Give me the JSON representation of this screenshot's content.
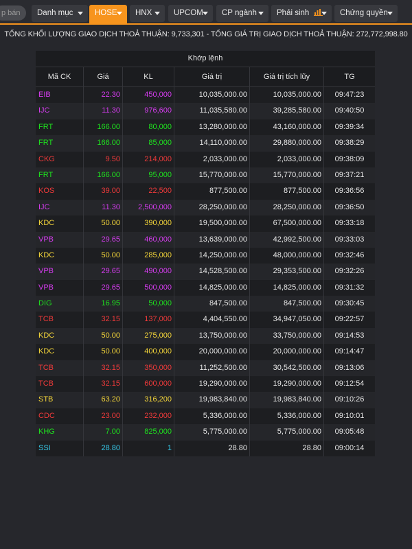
{
  "search": {
    "placeholder": "p bán"
  },
  "tabs": [
    {
      "label": "Danh mục",
      "active": false
    },
    {
      "label": "HOSE",
      "active": true
    },
    {
      "label": "HNX",
      "active": false
    },
    {
      "label": "UPCOM",
      "active": false
    },
    {
      "label": "CP ngành",
      "active": false
    },
    {
      "label": "Phái sinh",
      "active": false,
      "icon": "bar-chart-icon"
    },
    {
      "label": "Chứng quyền",
      "active": false
    }
  ],
  "summary": {
    "volume_label": "TỔNG KHỐI LƯỢNG GIAO DỊCH THOẢ THUẬN:",
    "volume_value": "9,733,301",
    "separator": "-",
    "value_label": "TỔNG GIÁ TRỊ GIAO DỊCH THOẢ THUẬN:",
    "value_value": "272,772,998.80"
  },
  "table": {
    "group_header": "Khớp lệnh",
    "columns": [
      "Mã CK",
      "Giá",
      "KL",
      "Giá trị",
      "Giá trị tích lũy",
      "TG"
    ],
    "colors": {
      "purple": "#d63cf0",
      "green": "#1ee31e",
      "red": "#f03a3a",
      "yellow": "#f5d63a",
      "cyan": "#36c8e8"
    },
    "rows": [
      {
        "symbol": "EIB",
        "price": "22.30",
        "volume": "450,000",
        "value": "10,035,000.00",
        "cumulative": "10,035,000.00",
        "time": "09:47:23",
        "color": "purple"
      },
      {
        "symbol": "IJC",
        "price": "11.30",
        "volume": "976,600",
        "value": "11,035,580.00",
        "cumulative": "39,285,580.00",
        "time": "09:40:50",
        "color": "purple"
      },
      {
        "symbol": "FRT",
        "price": "166.00",
        "volume": "80,000",
        "value": "13,280,000.00",
        "cumulative": "43,160,000.00",
        "time": "09:39:34",
        "color": "green"
      },
      {
        "symbol": "FRT",
        "price": "166.00",
        "volume": "85,000",
        "value": "14,110,000.00",
        "cumulative": "29,880,000.00",
        "time": "09:38:29",
        "color": "green"
      },
      {
        "symbol": "CKG",
        "price": "9.50",
        "volume": "214,000",
        "value": "2,033,000.00",
        "cumulative": "2,033,000.00",
        "time": "09:38:09",
        "color": "red"
      },
      {
        "symbol": "FRT",
        "price": "166.00",
        "volume": "95,000",
        "value": "15,770,000.00",
        "cumulative": "15,770,000.00",
        "time": "09:37:21",
        "color": "green"
      },
      {
        "symbol": "KOS",
        "price": "39.00",
        "volume": "22,500",
        "value": "877,500.00",
        "cumulative": "877,500.00",
        "time": "09:36:56",
        "color": "red"
      },
      {
        "symbol": "IJC",
        "price": "11.30",
        "volume": "2,500,000",
        "value": "28,250,000.00",
        "cumulative": "28,250,000.00",
        "time": "09:36:50",
        "color": "purple"
      },
      {
        "symbol": "KDC",
        "price": "50.00",
        "volume": "390,000",
        "value": "19,500,000.00",
        "cumulative": "67,500,000.00",
        "time": "09:33:18",
        "color": "yellow"
      },
      {
        "symbol": "VPB",
        "price": "29.65",
        "volume": "460,000",
        "value": "13,639,000.00",
        "cumulative": "42,992,500.00",
        "time": "09:33:03",
        "color": "purple"
      },
      {
        "symbol": "KDC",
        "price": "50.00",
        "volume": "285,000",
        "value": "14,250,000.00",
        "cumulative": "48,000,000.00",
        "time": "09:32:46",
        "color": "yellow"
      },
      {
        "symbol": "VPB",
        "price": "29.65",
        "volume": "490,000",
        "value": "14,528,500.00",
        "cumulative": "29,353,500.00",
        "time": "09:32:26",
        "color": "purple"
      },
      {
        "symbol": "VPB",
        "price": "29.65",
        "volume": "500,000",
        "value": "14,825,000.00",
        "cumulative": "14,825,000.00",
        "time": "09:31:32",
        "color": "purple"
      },
      {
        "symbol": "DIG",
        "price": "16.95",
        "volume": "50,000",
        "value": "847,500.00",
        "cumulative": "847,500.00",
        "time": "09:30:45",
        "color": "green"
      },
      {
        "symbol": "TCB",
        "price": "32.15",
        "volume": "137,000",
        "value": "4,404,550.00",
        "cumulative": "34,947,050.00",
        "time": "09:22:57",
        "color": "red"
      },
      {
        "symbol": "KDC",
        "price": "50.00",
        "volume": "275,000",
        "value": "13,750,000.00",
        "cumulative": "33,750,000.00",
        "time": "09:14:53",
        "color": "yellow"
      },
      {
        "symbol": "KDC",
        "price": "50.00",
        "volume": "400,000",
        "value": "20,000,000.00",
        "cumulative": "20,000,000.00",
        "time": "09:14:47",
        "color": "yellow"
      },
      {
        "symbol": "TCB",
        "price": "32.15",
        "volume": "350,000",
        "value": "11,252,500.00",
        "cumulative": "30,542,500.00",
        "time": "09:13:06",
        "color": "red"
      },
      {
        "symbol": "TCB",
        "price": "32.15",
        "volume": "600,000",
        "value": "19,290,000.00",
        "cumulative": "19,290,000.00",
        "time": "09:12:54",
        "color": "red"
      },
      {
        "symbol": "STB",
        "price": "63.20",
        "volume": "316,200",
        "value": "19,983,840.00",
        "cumulative": "19,983,840.00",
        "time": "09:10:26",
        "color": "yellow"
      },
      {
        "symbol": "CDC",
        "price": "23.00",
        "volume": "232,000",
        "value": "5,336,000.00",
        "cumulative": "5,336,000.00",
        "time": "09:10:01",
        "color": "red"
      },
      {
        "symbol": "KHG",
        "price": "7.00",
        "volume": "825,000",
        "value": "5,775,000.00",
        "cumulative": "5,775,000.00",
        "time": "09:05:48",
        "color": "green"
      },
      {
        "symbol": "SSI",
        "price": "28.80",
        "volume": "1",
        "value": "28.80",
        "cumulative": "28.80",
        "time": "09:00:14",
        "color": "cyan"
      }
    ]
  }
}
